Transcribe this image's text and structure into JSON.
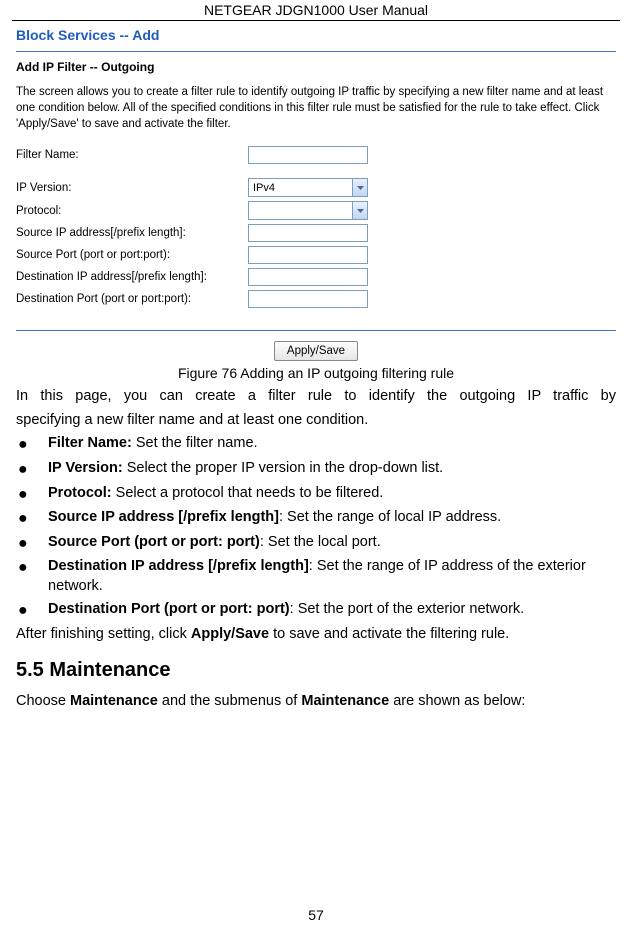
{
  "header": {
    "title": "NETGEAR JDGN1000 User Manual"
  },
  "section_title": "Block Services -- Add",
  "panel": {
    "title": "Add IP Filter -- Outgoing",
    "description": "The screen allows you to create a filter rule to identify outgoing IP traffic by specifying a new filter name and at least one condition below. All of the specified conditions in this filter rule must be satisfied for the rule to take effect. Click 'Apply/Save' to save and activate the filter.",
    "fields": {
      "filter_name": {
        "label": "Filter Name:",
        "value": ""
      },
      "ip_version": {
        "label": "IP Version:",
        "value": "IPv4"
      },
      "protocol": {
        "label": "Protocol:",
        "value": ""
      },
      "src_ip": {
        "label": "Source IP address[/prefix length]:",
        "value": ""
      },
      "src_port": {
        "label": "Source Port (port or port:port):",
        "value": ""
      },
      "dst_ip": {
        "label": "Destination IP address[/prefix length]:",
        "value": ""
      },
      "dst_port": {
        "label": "Destination Port (port or port:port):",
        "value": ""
      }
    },
    "apply_label": "Apply/Save"
  },
  "figure_caption": "Figure 76 Adding an IP outgoing filtering rule",
  "intro_line1": "In this page, you can create a filter rule to identify the outgoing IP traffic by",
  "intro_line2": "specifying a new filter name and at least one condition.",
  "bullets": [
    {
      "bold": "Filter Name:",
      "rest": " Set the filter name."
    },
    {
      "bold": "IP Version:",
      "rest": " Select the proper IP version in the drop-down list."
    },
    {
      "bold": "Protocol:",
      "rest": " Select a protocol that needs to be filtered."
    },
    {
      "bold": "Source IP address [/prefix length]",
      "rest": ": Set the range of local IP address."
    },
    {
      "bold": "Source Port (port or port: port)",
      "rest": ": Set the local port."
    },
    {
      "bold": "Destination IP address [/prefix length]",
      "rest": ": Set the range of IP address of the exterior network."
    },
    {
      "bold": "Destination Port (port or port: port)",
      "rest": ": Set the port of the exterior network."
    }
  ],
  "after_text_prefix": "After finishing setting, click ",
  "after_text_bold": "Apply/Save",
  "after_text_suffix": " to save and activate the filtering rule.",
  "h2": "5.5  Maintenance",
  "maint_prefix": "Choose ",
  "maint_bold1": "Maintenance",
  "maint_mid": " and the submenus of ",
  "maint_bold2": "Maintenance",
  "maint_suffix": " are shown as below:",
  "page_number": "57"
}
